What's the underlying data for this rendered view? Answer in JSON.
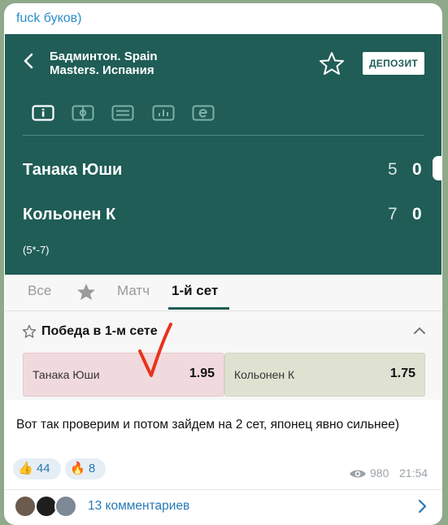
{
  "post": {
    "channel_name": "fuck буков)",
    "caption": "Вот так проверим и потом зайдем на 2 сет, японец явно сильнее)",
    "reactions": [
      {
        "emoji": "👍",
        "count": "44"
      },
      {
        "emoji": "🔥",
        "count": "8"
      }
    ],
    "views": "980",
    "time": "21:54",
    "comments_label": "13 комментариев"
  },
  "screenshot": {
    "event_title_line1": "Бадминтон. Spain",
    "event_title_line2": "Masters. Испания",
    "deposit_label": "ДЕПОЗИТ",
    "icon_tabs": [
      "info-icon",
      "field-icon",
      "list-icon",
      "stats-icon",
      "e-icon"
    ],
    "players": [
      {
        "name": "Танака Юши",
        "set_score": "5",
        "sets_won": "0"
      },
      {
        "name": "Кольонен К",
        "set_score": "7",
        "sets_won": "0"
      }
    ],
    "sets_summary": "(5*-7)",
    "tabs": [
      {
        "label": "Все"
      },
      {
        "label": "favorites-star"
      },
      {
        "label": "Матч"
      },
      {
        "label": "1-й сет",
        "active": true
      }
    ],
    "market_title": "Победа в 1-м сете",
    "odds": [
      {
        "name": "Танака Юши",
        "coef": "1.95"
      },
      {
        "name": "Кольонен К",
        "coef": "1.75"
      }
    ],
    "colors": {
      "header": "#1f5d56",
      "odd_a": "#f1dadd",
      "odd_b": "#dfe2d1",
      "check_mark": "#e8331c"
    }
  }
}
